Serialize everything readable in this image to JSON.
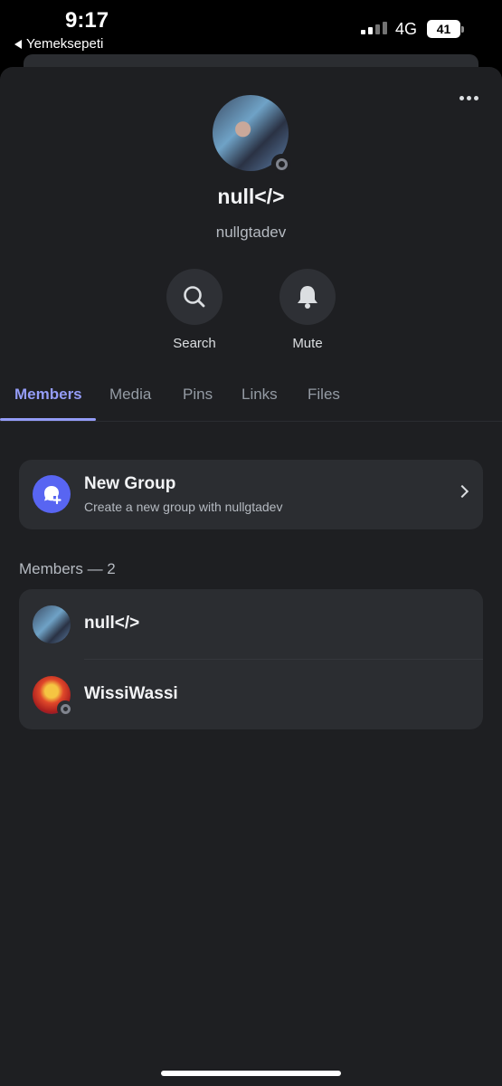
{
  "status_bar": {
    "time": "9:17",
    "back_app": "Yemeksepeti",
    "network": "4G",
    "battery": "41"
  },
  "profile": {
    "display_name": "null</>",
    "username": "nullgtadev",
    "status": "offline"
  },
  "actions": [
    {
      "label": "Search",
      "icon": "search-icon"
    },
    {
      "label": "Mute",
      "icon": "bell-icon"
    }
  ],
  "tabs": [
    {
      "label": "Members",
      "active": true
    },
    {
      "label": "Media",
      "active": false
    },
    {
      "label": "Pins",
      "active": false
    },
    {
      "label": "Links",
      "active": false
    },
    {
      "label": "Files",
      "active": false
    }
  ],
  "new_group": {
    "title": "New Group",
    "subtitle": "Create a new group with nullgtadev"
  },
  "members_section": {
    "title": "Members — 2",
    "members": [
      {
        "name": "null</>"
      },
      {
        "name": "WissiWassi",
        "status": "offline"
      }
    ]
  },
  "colors": {
    "accent": "#949cf7",
    "brand": "#5865f2",
    "background": "#1e1f22",
    "card": "#2b2d31"
  }
}
